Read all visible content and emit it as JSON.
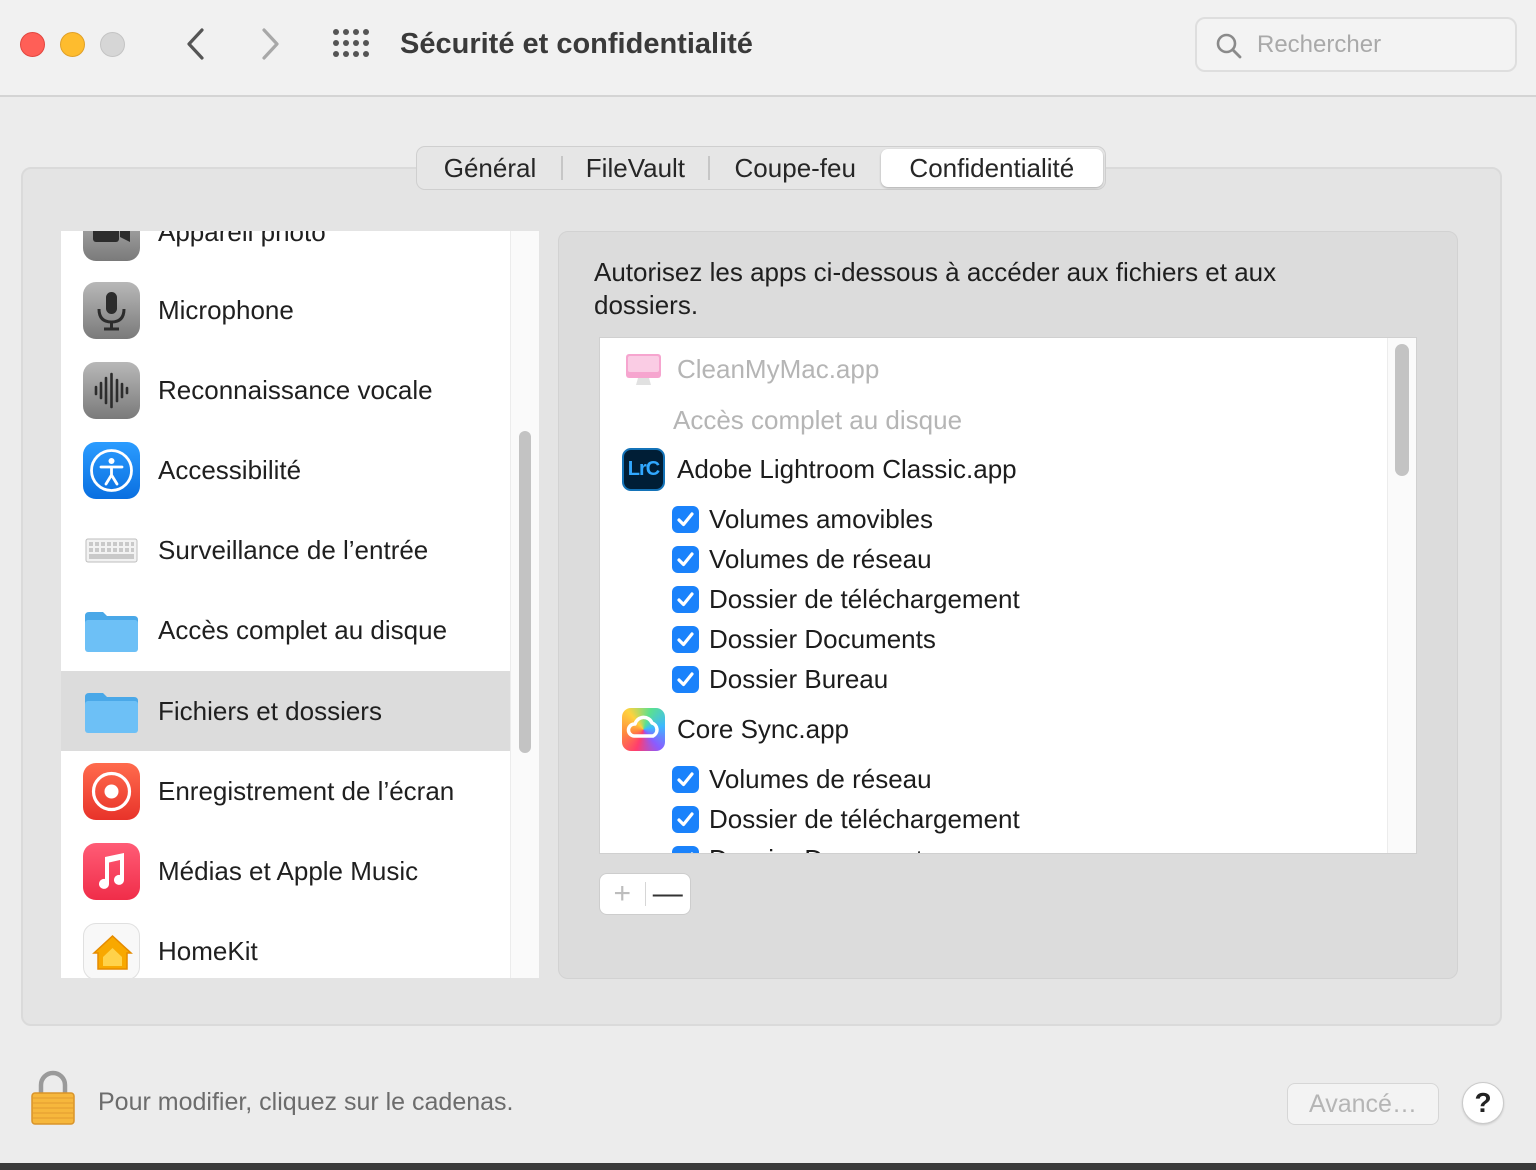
{
  "window": {
    "title": "Sécurité et confidentialité",
    "search_placeholder": "Rechercher"
  },
  "tabs": [
    {
      "label": "Général",
      "selected": false
    },
    {
      "label": "FileVault",
      "selected": false
    },
    {
      "label": "Coupe-feu",
      "selected": false
    },
    {
      "label": "Confidentialité",
      "selected": true
    }
  ],
  "sidebar": {
    "items": [
      {
        "label": "Appareil photo",
        "icon": "camera-icon"
      },
      {
        "label": "Microphone",
        "icon": "microphone-icon"
      },
      {
        "label": "Reconnaissance vocale",
        "icon": "waveform-icon"
      },
      {
        "label": "Accessibilité",
        "icon": "accessibility-icon"
      },
      {
        "label": "Surveillance de l’entrée",
        "icon": "keyboard-icon"
      },
      {
        "label": "Accès complet au disque",
        "icon": "folder-icon"
      },
      {
        "label": "Fichiers et dossiers",
        "icon": "folder-icon",
        "selected": true
      },
      {
        "label": "Enregistrement de l’écran",
        "icon": "screen-record-icon"
      },
      {
        "label": "Médias et Apple Music",
        "icon": "music-note-icon"
      },
      {
        "label": "HomeKit",
        "icon": "home-icon"
      }
    ]
  },
  "main": {
    "description": "Autorisez les apps ci-dessous à accéder aux fichiers et aux dossiers.",
    "apps": [
      {
        "name": "CleanMyMac.app",
        "icon": "cleanmymac-icon",
        "dimmed": true,
        "note": "Accès complet au disque"
      },
      {
        "name": "Adobe Lightroom Classic.app",
        "icon": "lightroom-icon",
        "icon_text": "LrC",
        "permissions": [
          {
            "label": "Volumes amovibles",
            "checked": true
          },
          {
            "label": "Volumes de réseau",
            "checked": true
          },
          {
            "label": "Dossier de téléchargement",
            "checked": true
          },
          {
            "label": "Dossier Documents",
            "checked": true
          },
          {
            "label": "Dossier Bureau",
            "checked": true
          }
        ]
      },
      {
        "name": "Core Sync.app",
        "icon": "creative-cloud-icon",
        "permissions": [
          {
            "label": "Volumes de réseau",
            "checked": true
          },
          {
            "label": "Dossier de téléchargement",
            "checked": true
          },
          {
            "label": "Dossier Documents",
            "checked": true
          }
        ]
      }
    ],
    "add_label": "+",
    "remove_label": "—"
  },
  "footer": {
    "lock_text": "Pour modifier, cliquez sur le cadenas.",
    "advanced_label": "Avancé…",
    "help_label": "?"
  },
  "colors": {
    "accent": "#1a82fb",
    "close": "#ff5f57",
    "minimize": "#febc2e"
  }
}
